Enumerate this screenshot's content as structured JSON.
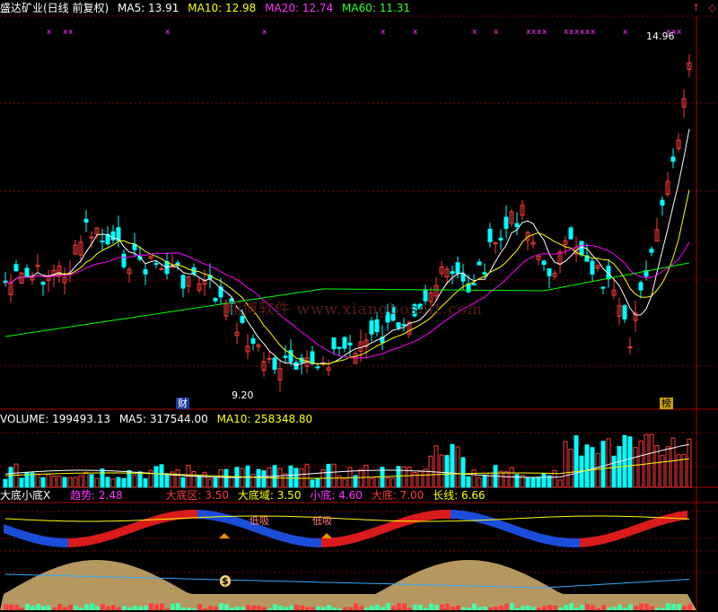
{
  "main_header": {
    "title": "盛达矿业(日线 前复权)",
    "ma5_label": "MA5: 13.91",
    "ma10_label": "MA10: 12.98",
    "ma20_label": "MA20: 12.74",
    "ma60_label": "MA60: 11.31"
  },
  "annotations": {
    "high_label": "14.96",
    "low_label": "9.20",
    "finance_tag": "财",
    "rank_tag": "榜"
  },
  "watermark": "翔博软件 www.xiangbosoft.com",
  "volume_header": {
    "volume_label": "VOLUME: 199493.13",
    "ma5_label": "MA5: 317544.00",
    "ma10_label": "MA10: 258348.80"
  },
  "indicator_header": {
    "name": "大底小底X",
    "trend_label": "趋势: 2.48",
    "dadiqu_label": "大底区: 3.50",
    "dadiyu_label": "大底域: 3.50",
    "xiaodi_label": "小底: 4.60",
    "dadi_label": "大底: 7.00",
    "changxian_label": "长线: 6.66"
  },
  "indicator_labels": {
    "dixi_1": "低吸",
    "dixi_2": "低吸",
    "money_icon": "$"
  },
  "icons": {
    "up": "up-arrow-icon",
    "diamond": "diamond-icon"
  },
  "colors": {
    "up": "#ff3a3a",
    "down": "#00ffff",
    "ma5": "#ffffff",
    "ma10": "#ffff00",
    "ma20": "#ff00ff",
    "ma60": "#00ff00",
    "grid": "#8b0000"
  }
}
